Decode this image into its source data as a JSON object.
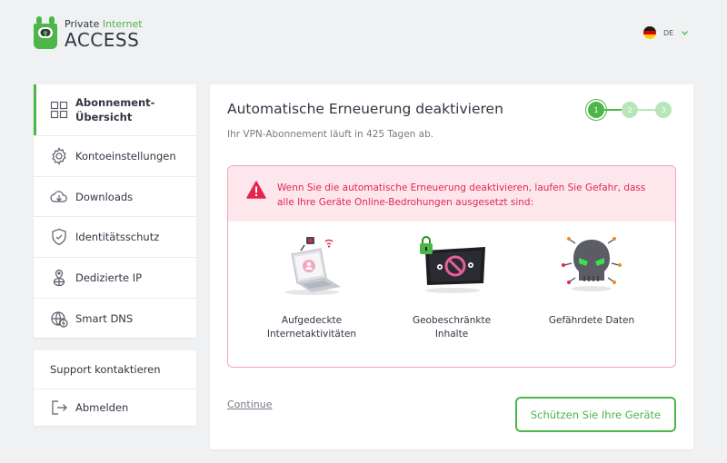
{
  "brand": {
    "line1_a": "Private ",
    "line1_b": "Internet",
    "line2": "ACCESS",
    "green": "#4cb649"
  },
  "language": {
    "code": "DE",
    "flag_icon": "germany-flag-icon"
  },
  "sidebar": {
    "items": [
      {
        "label": "Abonnement-Übersicht",
        "icon": "grid-icon",
        "active": true
      },
      {
        "label": "Kontoeinstellungen",
        "icon": "gear-icon"
      },
      {
        "label": "Downloads",
        "icon": "cloud-download-icon"
      },
      {
        "label": "Identitätsschutz",
        "icon": "shield-check-icon"
      },
      {
        "label": "Dedizierte IP",
        "icon": "location-globe-icon"
      },
      {
        "label": "Smart DNS",
        "icon": "globe-lightning-icon"
      }
    ],
    "support_label": "Support kontaktieren",
    "logout_label": "Abmelden",
    "logout_icon": "logout-icon"
  },
  "main": {
    "title": "Automatische Erneuerung deaktivieren",
    "subtitle": "Ihr VPN-Abonnement läuft in 425 Tagen ab.",
    "steps": [
      "1",
      "2",
      "3"
    ],
    "current_step": 1,
    "warning": {
      "text": "Wenn Sie die automatische Erneuerung deaktivieren, laufen Sie Gefahr, dass alle Ihre Geräte Online-Bedrohungen ausgesetzt sind:",
      "icon": "warning-triangle-icon",
      "color": "#e4264f",
      "bg": "#fde7ec"
    },
    "risks": [
      {
        "line1": "Aufgedeckte",
        "line2": "Internetaktivitäten",
        "icon": "exposed-laptop-illustration"
      },
      {
        "line1": "Geobeschränkte",
        "line2": "Inhalte",
        "icon": "geo-blocked-screen-illustration"
      },
      {
        "line1": "Gefährdete Daten",
        "line2": "",
        "icon": "threat-skull-illustration"
      }
    ],
    "continue_label": "Continue",
    "protect_label": "Schützen Sie Ihre Geräte"
  }
}
